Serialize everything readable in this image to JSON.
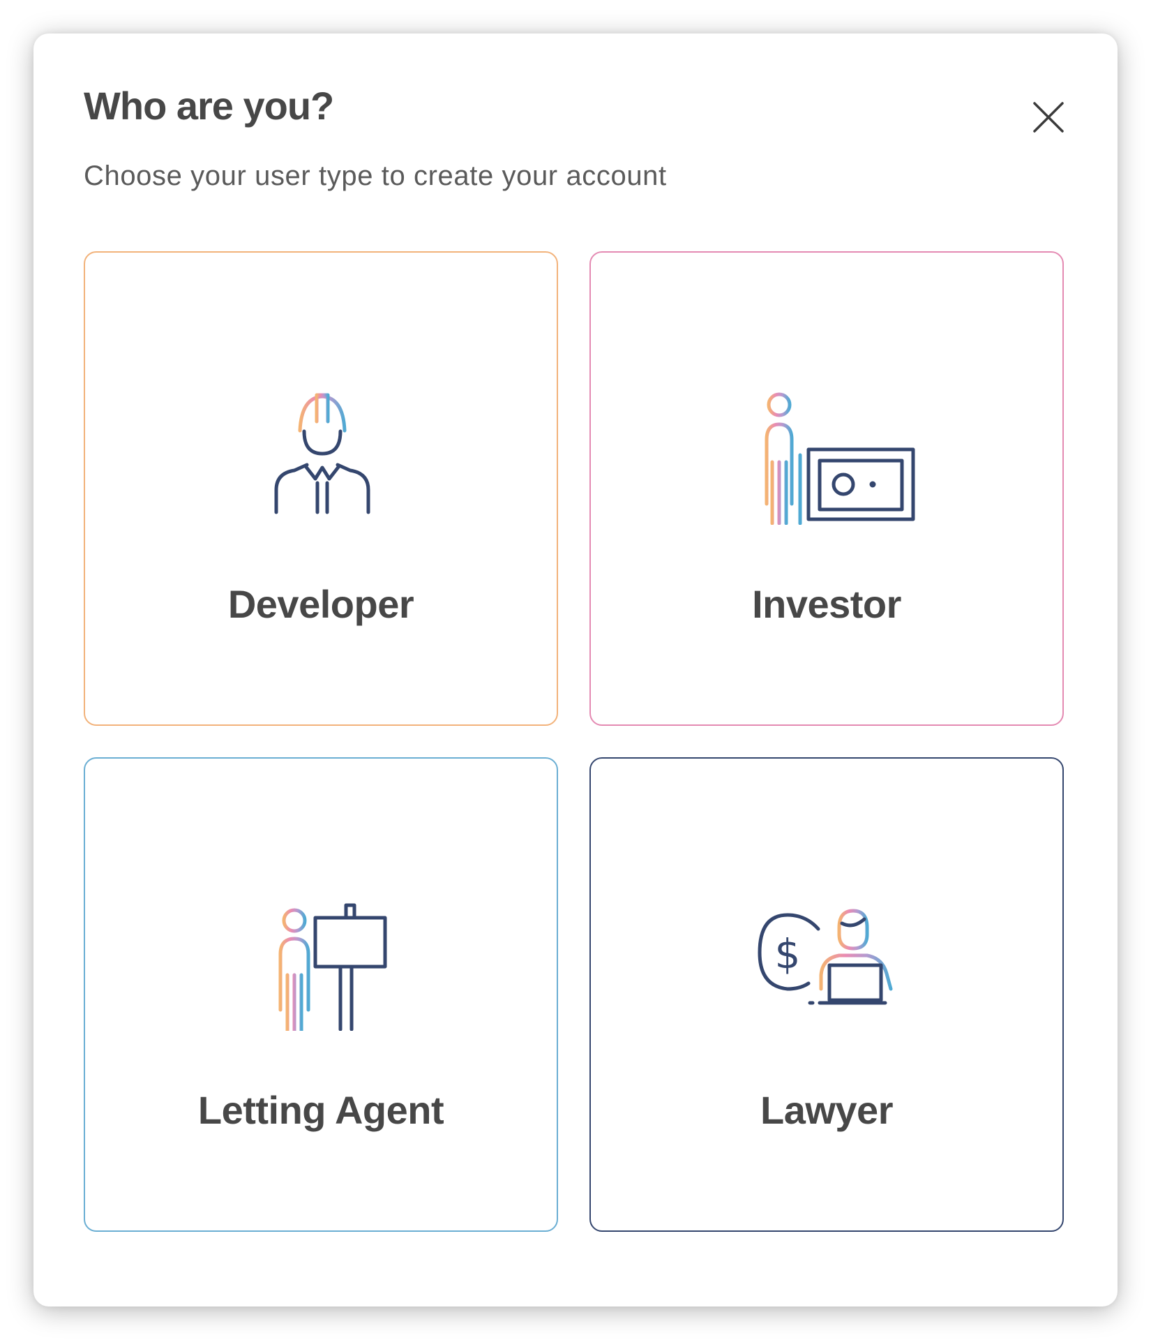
{
  "modal": {
    "title": "Who are you?",
    "subtitle": "Choose your user type to create your account",
    "close_icon": "close-icon"
  },
  "colors": {
    "text": "#474747",
    "orange": "#f2b27a",
    "pink": "#e48ab2",
    "blue": "#6aaed3",
    "navy": "#34466e"
  },
  "cards": [
    {
      "label": "Developer",
      "icon": "construction-worker-icon",
      "border_color": "#f2b27a"
    },
    {
      "label": "Investor",
      "icon": "investor-money-icon",
      "border_color": "#e48ab2"
    },
    {
      "label": "Letting Agent",
      "icon": "letting-agent-sign-icon",
      "border_color": "#6aaed3"
    },
    {
      "label": "Lawyer",
      "icon": "lawyer-laptop-icon",
      "border_color": "#34466e"
    }
  ]
}
